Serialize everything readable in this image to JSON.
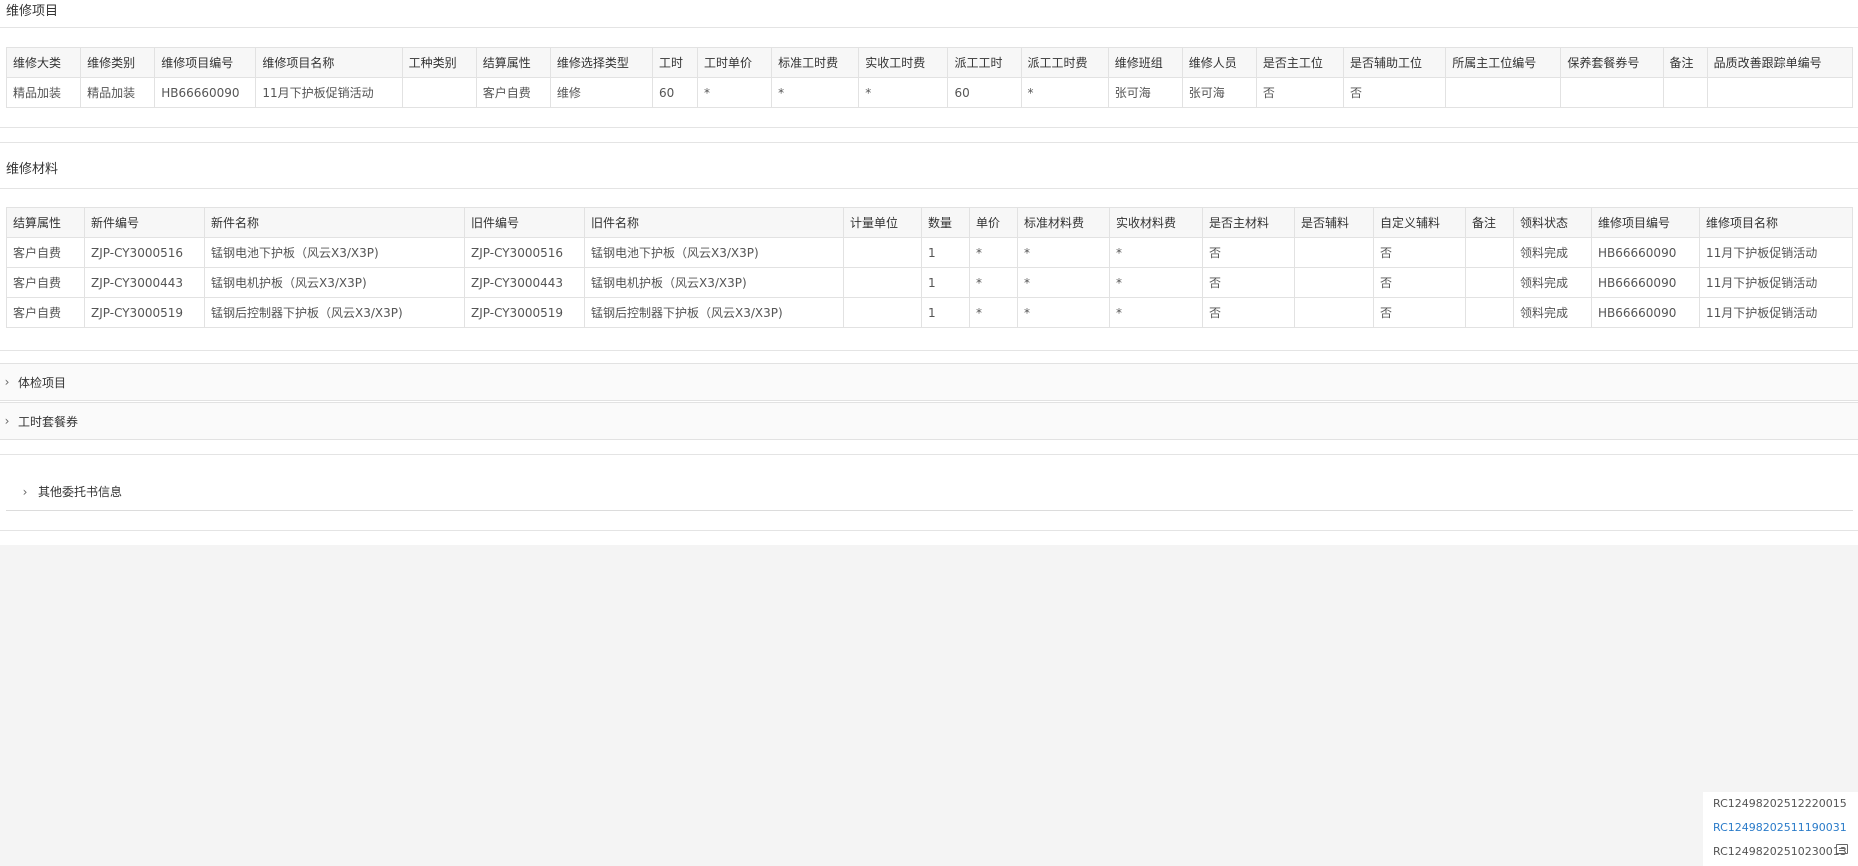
{
  "repair_items": {
    "title": "维修项目",
    "columns": [
      "维修大类",
      "维修类别",
      "维修项目编号",
      "维修项目名称",
      "工种类别",
      "结算属性",
      "维修选择类型",
      "工时",
      "工时单价",
      "标准工时费",
      "实收工时费",
      "派工工时",
      "派工工时费",
      "维修班组",
      "维修人员",
      "是否主工位",
      "是否辅助工位",
      "所属主工位编号",
      "保养套餐券号",
      "备注",
      "品质改善跟踪单编号"
    ],
    "rows": [
      [
        "精品加装",
        "精品加装",
        "HB66660090",
        "11月下护板促销活动",
        "",
        "客户自费",
        "维修",
        "60",
        "*",
        "*",
        "*",
        "60",
        "*",
        "张可海",
        "张可海",
        "否",
        "否",
        "",
        "",
        "",
        ""
      ]
    ]
  },
  "repair_materials": {
    "title": "维修材料",
    "columns": [
      "结算属性",
      "新件编号",
      "新件名称",
      "旧件编号",
      "旧件名称",
      "计量单位",
      "数量",
      "单价",
      "标准材料费",
      "实收材料费",
      "是否主材料",
      "是否辅料",
      "自定义辅料",
      "备注",
      "领料状态",
      "维修项目编号",
      "维修项目名称"
    ],
    "rows": [
      [
        "客户自费",
        "ZJP-CY3000516",
        "锰钢电池下护板（风云X3/X3P)",
        "ZJP-CY3000516",
        "锰钢电池下护板（风云X3/X3P)",
        "",
        "1",
        "*",
        "*",
        "*",
        "否",
        "",
        "否",
        "",
        "领料完成",
        "HB66660090",
        "11月下护板促销活动"
      ],
      [
        "客户自费",
        "ZJP-CY3000443",
        "锰钢电机护板（风云X3/X3P)",
        "ZJP-CY3000443",
        "锰钢电机护板（风云X3/X3P)",
        "",
        "1",
        "*",
        "*",
        "*",
        "否",
        "",
        "否",
        "",
        "领料完成",
        "HB66660090",
        "11月下护板促销活动"
      ],
      [
        "客户自费",
        "ZJP-CY3000519",
        "锰钢后控制器下护板（风云X3/X3P)",
        "ZJP-CY3000519",
        "锰钢后控制器下护板（风云X3/X3P)",
        "",
        "1",
        "*",
        "*",
        "*",
        "否",
        "",
        "否",
        "",
        "领料完成",
        "HB66660090",
        "11月下护板促销活动"
      ]
    ]
  },
  "collapsed_sections": [
    {
      "label": "体检项目",
      "icon": "chevron-right-icon"
    },
    {
      "label": "工时套餐券",
      "icon": "chevron-right-icon"
    }
  ],
  "other_section": {
    "label": "其他委托书信息",
    "icon": "chevron-right-icon"
  },
  "dropdown": {
    "items": [
      {
        "text": "RC12498202512220015",
        "active": false
      },
      {
        "text": "RC12498202511190031",
        "active": true
      },
      {
        "text": "RC12498202510230013",
        "active": false
      }
    ]
  },
  "colors": {
    "active_link": "#2a7bc9",
    "background": "#f4f4f4",
    "panel": "#ffffff"
  }
}
